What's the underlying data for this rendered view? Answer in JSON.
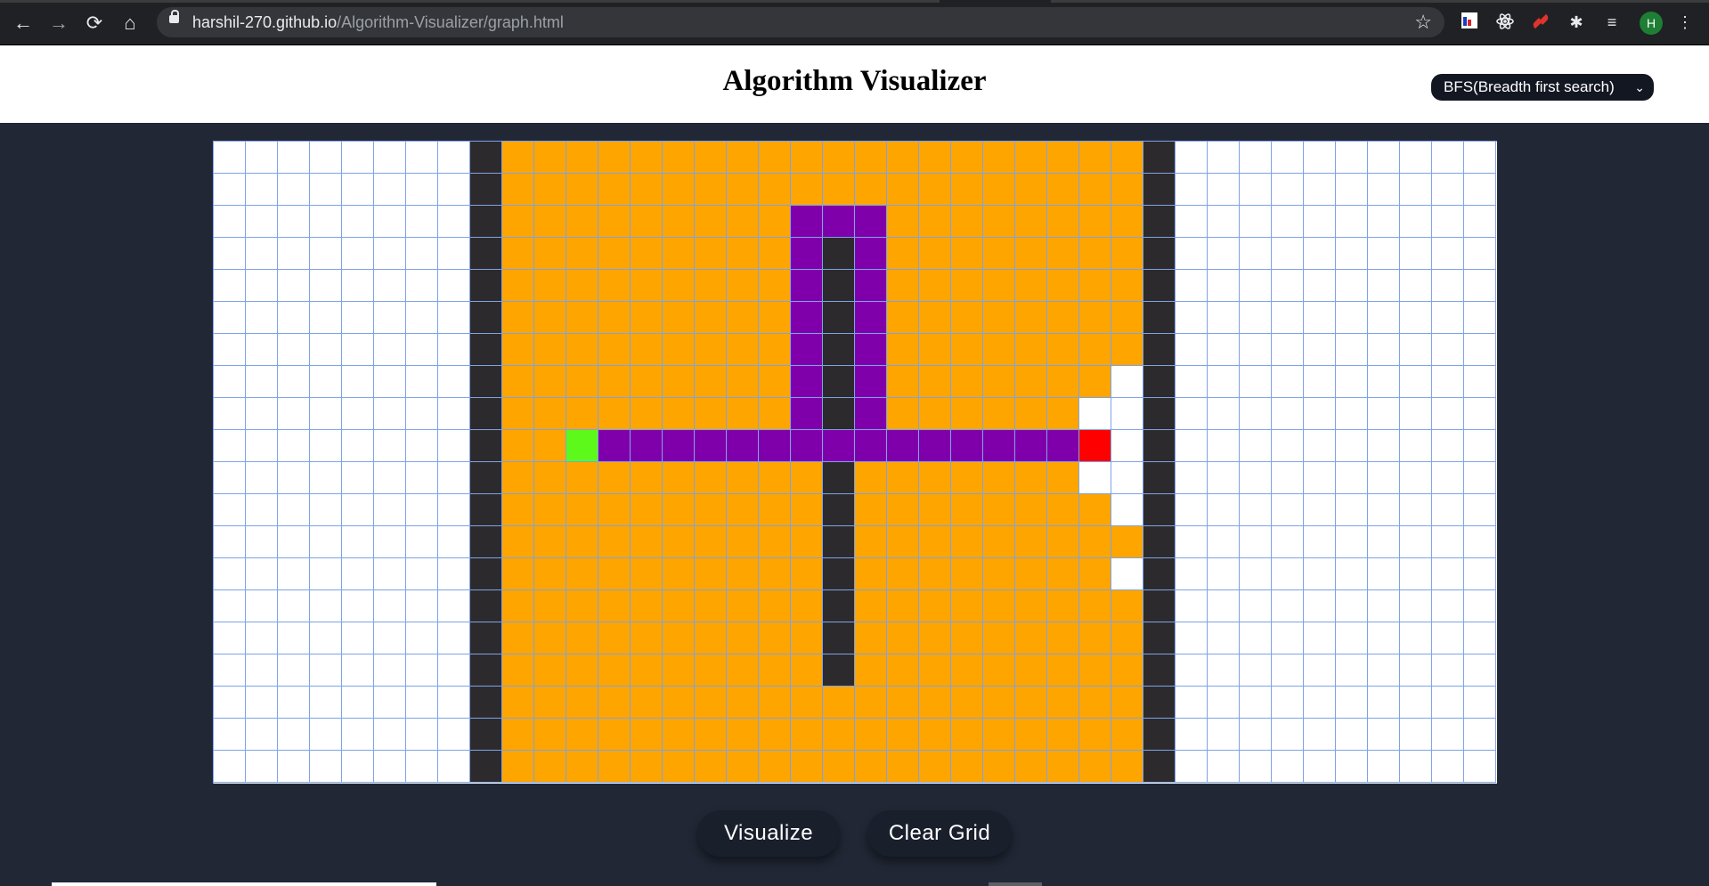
{
  "browser": {
    "url_domain": "harshil-270.github.io",
    "url_path": "/Algorithm-Visualizer/graph.html",
    "back_icon": "←",
    "forward_icon": "→",
    "reload_icon": "⟳",
    "home_icon": "⌂",
    "star_icon": "☆",
    "extensions_icon": "✱",
    "media_icon": "≡",
    "menu_icon": "⋮",
    "profile_initial": "H"
  },
  "header": {
    "title": "Algorithm Visualizer",
    "algorithm_selected": "BFS(Breadth first search)",
    "chevron_icon": "⌄"
  },
  "grid": {
    "rows": 20,
    "cols": 40,
    "legend": {
      ".": "empty",
      "#": "wall",
      "o": "visited",
      "p": "path",
      "S": "start",
      "T": "target"
    },
    "cells": [
      "........#oooooooooooooooooooo#..........",
      "........#oooooooooooooooooooo#..........",
      "........#ooooooooopppoooooooo#..........",
      "........#ooooooooop#poooooooo#..........",
      "........#ooooooooop#poooooooo#..........",
      "........#ooooooooop#poooooooo#..........",
      "........#ooooooooop#poooooooo#..........",
      "........#ooooooooop#pooooooo.#..........",
      "........#ooooooooop#poooooo..#..........",
      "........#ooSpppppppppppppppT.#..........",
      "........#oooooooooo#ooooooo..#..........",
      "........#oooooooooo#oooooooo.#..........",
      "........#oooooooooo#ooooooooo#..........",
      "........#oooooooooo#oooooooo.#..........",
      "........#oooooooooo#ooooooooo#..........",
      "........#oooooooooo#ooooooooo#..........",
      "........#oooooooooo#ooooooooo#..........",
      "........#oooooooooooooooooooo#..........",
      "........#oooooooooooooooooooo#..........",
      "........#oooooooooooooooooooo#.........."
    ]
  },
  "buttons": {
    "visualize": "Visualize",
    "clear_grid": "Clear Grid"
  }
}
